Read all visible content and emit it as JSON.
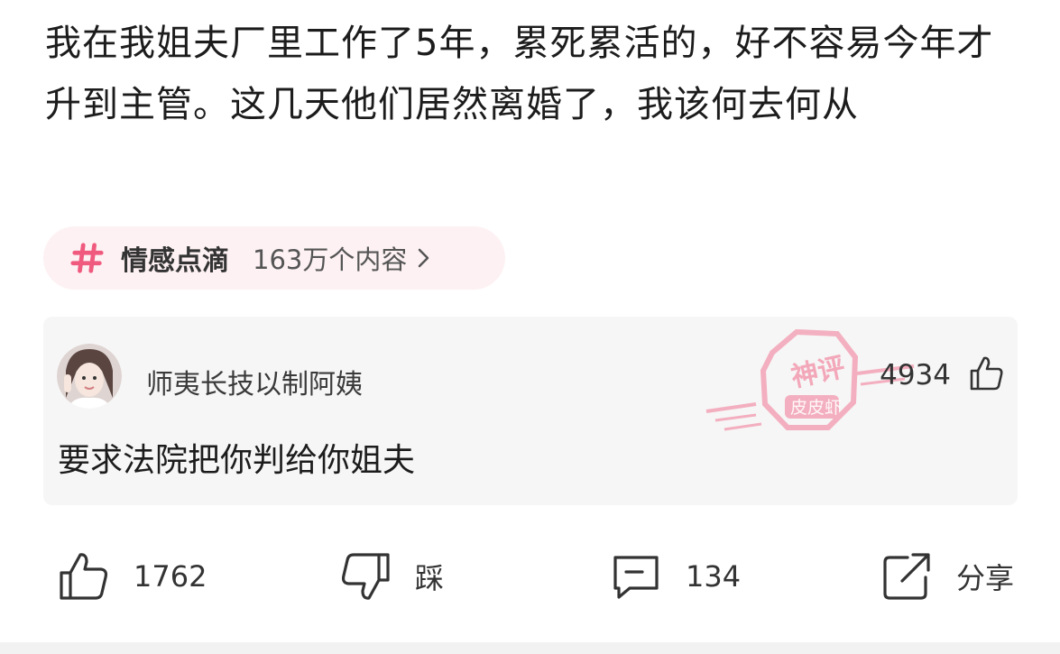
{
  "post": {
    "text": "我在我姐夫厂里工作了5年，累死累活的，好不容易今年才升到主管。这几天他们居然离婚了，我该何去何从"
  },
  "topic": {
    "name": "情感点滴",
    "count": "163万个内容"
  },
  "comment": {
    "username": "师夷长技以制阿姨",
    "likes": "4934",
    "text": "要求法院把你判给你姐夫",
    "stamp_line1": "神评",
    "stamp_line2": "皮皮虾"
  },
  "actions": {
    "like_count": "1762",
    "dislike_label": "踩",
    "comment_count": "134",
    "share_label": "分享"
  },
  "colors": {
    "accent_pink": "#f05a7e",
    "pill_background": "#fdf1f3",
    "card_background": "#f6f6f6"
  }
}
